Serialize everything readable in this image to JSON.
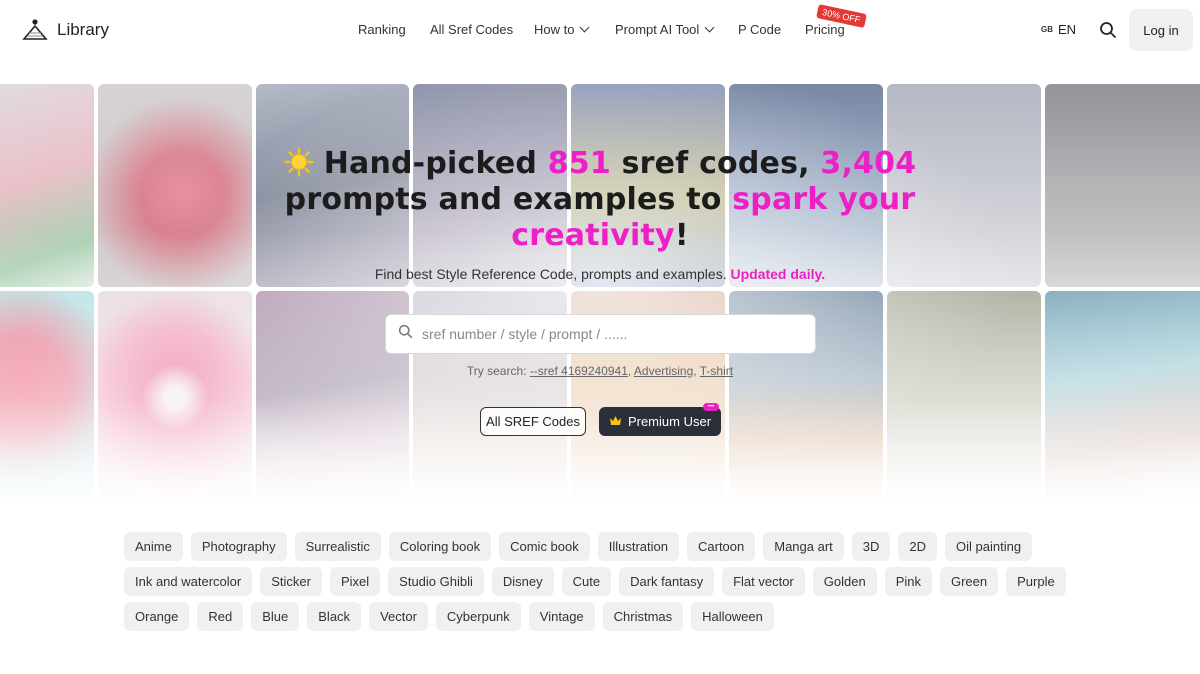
{
  "header": {
    "logo_text": "Library",
    "nav": [
      {
        "label": "Ranking"
      },
      {
        "label": "All Sref Codes"
      },
      {
        "label": "How to"
      },
      {
        "label": "Prompt AI Tool"
      },
      {
        "label": "P Code"
      },
      {
        "label": "Pricing"
      }
    ],
    "promo_badge": "30% OFF",
    "lang_flag": "GB",
    "lang_label": "EN",
    "login_label": "Log in"
  },
  "hero": {
    "title_p1": "Hand-picked ",
    "title_n1": "851",
    "title_p2": " sref codes, ",
    "title_n2": "3,404",
    "title_p3": " prompts and examples to ",
    "title_hl": "spark your creativity",
    "title_end": "!",
    "subtitle": "Find best Style Reference Code, prompts and examples.",
    "subtitle_hl": "Updated daily.",
    "search_placeholder": "sref number / style / prompt / ......",
    "try_label": "Try search:",
    "try_links": [
      "--sref 4169240941",
      "Advertising",
      "T-shirt"
    ],
    "try_sep": ",",
    "btn_all": "All SREF Codes",
    "btn_premium": "Premium User",
    "premium_badge": "•••"
  },
  "tags": {
    "row1": [
      "Anime",
      "Photography",
      "Surrealistic",
      "Coloring book",
      "Comic book",
      "Illustration",
      "Cartoon",
      "Manga art",
      "3D",
      "2D",
      "Oil painting"
    ],
    "row2": [
      "Ink and watercolor",
      "Sticker",
      "Pixel",
      "Studio Ghibli",
      "Disney",
      "Cute",
      "Dark fantasy",
      "Flat vector",
      "Golden",
      "Pink",
      "Green",
      "Purple"
    ],
    "row3": [
      "Orange",
      "Red",
      "Blue",
      "Black",
      "Vector",
      "Cyberpunk",
      "Vintage",
      "Christmas",
      "Halloween"
    ]
  },
  "colors": {
    "accent": "#ee1fc6",
    "premium_bg": "#2a2f3a",
    "tag_bg": "#f0f0f0",
    "promo_red": "#e53935"
  },
  "icons": {
    "logo": "pyramid-logo-icon",
    "search": "search-icon",
    "input_search": "search-icon",
    "chevron": "chevron-down-icon",
    "sun": "sun-icon",
    "crown": "crown-icon"
  }
}
